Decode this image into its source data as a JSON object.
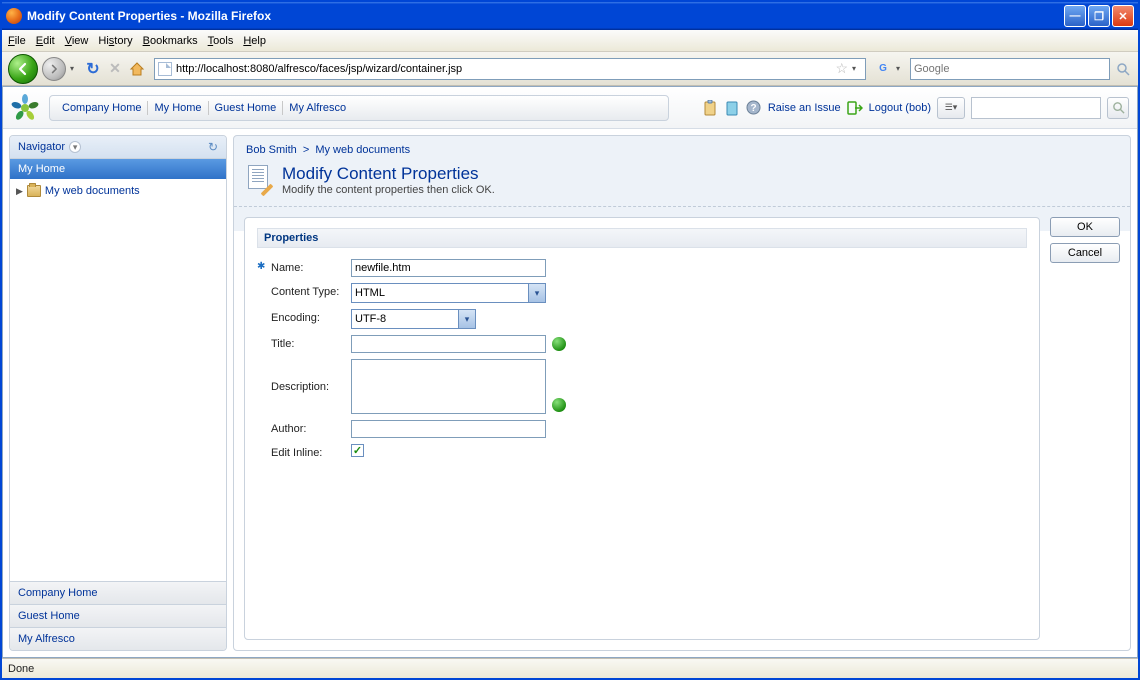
{
  "window": {
    "title": "Modify Content Properties - Mozilla Firefox"
  },
  "menu": {
    "file": "File",
    "edit": "Edit",
    "view": "View",
    "history": "History",
    "bookmarks": "Bookmarks",
    "tools": "Tools",
    "help": "Help"
  },
  "toolbar": {
    "url": "http://localhost:8080/alfresco/faces/jsp/wizard/container.jsp",
    "search_placeholder": "Google"
  },
  "app_nav": {
    "company_home": "Company Home",
    "my_home": "My Home",
    "guest_home": "Guest Home",
    "my_alfresco": "My Alfresco"
  },
  "app_right": {
    "raise": "Raise an Issue",
    "logout": "Logout (bob)"
  },
  "sidebar": {
    "title": "Navigator",
    "selected": "My Home",
    "tree_item": "My web documents",
    "links": {
      "company_home": "Company Home",
      "guest_home": "Guest Home",
      "my_alfresco": "My Alfresco"
    }
  },
  "breadcrumb": {
    "a": "Bob Smith",
    "b": "My web documents"
  },
  "page": {
    "title": "Modify Content Properties",
    "sub": "Modify the content properties then click OK."
  },
  "props": {
    "section": "Properties",
    "labels": {
      "name": "Name:",
      "content_type": "Content Type:",
      "encoding": "Encoding:",
      "title": "Title:",
      "description": "Description:",
      "author": "Author:",
      "edit_inline": "Edit Inline:"
    },
    "values": {
      "name": "newfile.htm",
      "content_type": "HTML",
      "encoding": "UTF-8",
      "title": "",
      "description": "",
      "author": "",
      "edit_inline": true
    }
  },
  "buttons": {
    "ok": "OK",
    "cancel": "Cancel"
  },
  "status": "Done"
}
